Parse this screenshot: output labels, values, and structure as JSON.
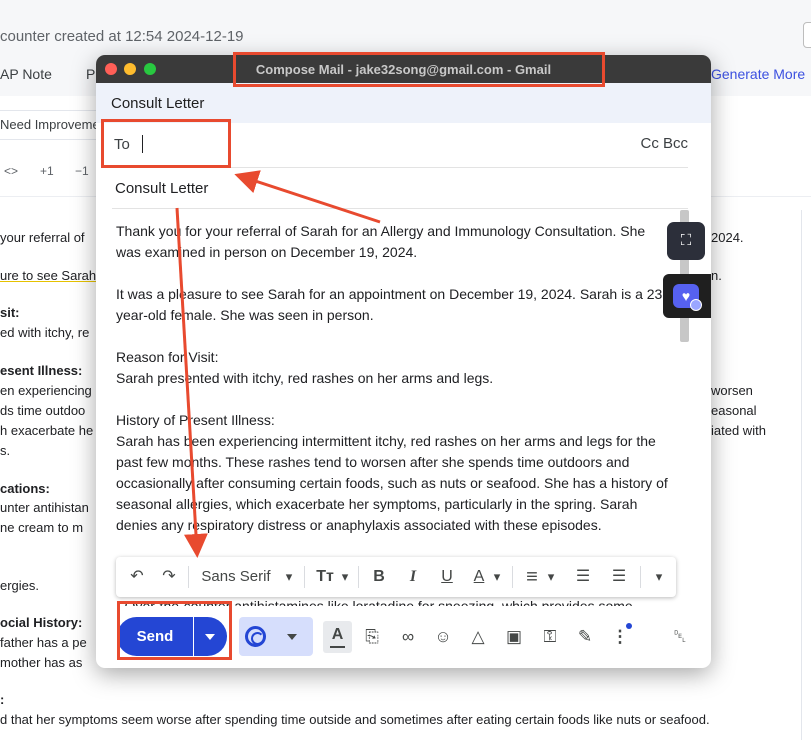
{
  "background": {
    "title": "counter created at 12:54 2024-12-19",
    "tabs": [
      "AP Note",
      "P",
      "Generate More"
    ],
    "chip_label": "Need Improvement",
    "toolbar_items": [
      "<>",
      "+1",
      "−1"
    ],
    "lines": [
      {
        "text": "your referral of",
        "bold": false
      },
      {
        "text": "ure to see Sarah",
        "bold": false
      },
      {
        "text": "sit:",
        "bold": true
      },
      {
        "text": "ed with itchy, re",
        "bold": false
      },
      {
        "text": "esent Illness:",
        "bold": true
      },
      {
        "text": "en experiencing",
        "bold": false
      },
      {
        "text": "ds time outdoo",
        "bold": false
      },
      {
        "text": "h exacerbate he",
        "bold": false
      },
      {
        "text": "s.",
        "bold": false
      },
      {
        "text": "cations:",
        "bold": true
      },
      {
        "text": "unter antihistan",
        "bold": false
      },
      {
        "text": "ne cream to m",
        "bold": false
      },
      {
        "text": "ergies.",
        "bold": false
      },
      {
        "text": "ocial History:",
        "bold": true
      },
      {
        "text": "father has a pe",
        "bold": false
      },
      {
        "text": "mother has as",
        "bold": false
      },
      {
        "text": ":",
        "bold": true
      },
      {
        "text": "d that her symptoms seem worse after spending time outside and sometimes after eating certain foods like nuts or seafood.",
        "bold": false
      }
    ],
    "right_fragments": [
      "2024.",
      "n.",
      "worsen",
      "easonal",
      "iated with"
    ]
  },
  "compose": {
    "window_title": "Compose Mail - jake32song@gmail.com - Gmail",
    "header_subject": "Consult Letter",
    "to_label": "To",
    "cc_bcc": "Cc Bcc",
    "subject": "Consult Letter",
    "body": [
      "Thank you for your referral of Sarah for an Allergy and Immunology Consultation. She was examined in person on December 19, 2024.",
      "It was a pleasure to see Sarah for an appointment on December 19, 2024. Sarah is a 23-year-old female. She was seen in person.",
      "Reason for Visit:",
      "Sarah presented with itchy, red rashes on her arms and legs.",
      "History of Present Illness:",
      "Sarah has been experiencing intermittent itchy, red rashes on her arms and legs for the past few months. These rashes tend to worsen after she spends time outdoors and occasionally after consuming certain foods, such as nuts or seafood. She has a history of seasonal allergies, which exacerbate her symptoms, particularly in the spring. Sarah denies any respiratory distress or anaphylaxis associated with these episodes."
    ],
    "hidden_line": "- Over-the-counter antihistamines like loratadine for sneezing, which provides some",
    "font_name": "Sans Serif",
    "send_label": "Send"
  },
  "icons": {
    "undo": "undo-icon",
    "redo": "redo-icon",
    "text_size": "text-size-icon",
    "bold": "bold-icon",
    "italic": "italic-icon",
    "underline": "underline-icon",
    "text_color": "text-color-icon",
    "align": "align-icon",
    "numbered_list": "numbered-list-icon",
    "bulleted_list": "bulleted-list-icon",
    "more_formatting": "more-formatting-icon",
    "attach": "attach-icon",
    "link": "link-icon",
    "emoji": "emoji-icon",
    "drive": "drive-icon",
    "photo": "photo-icon",
    "lock": "confidential-lock-icon",
    "signature": "signature-pen-icon",
    "more": "more-options-icon",
    "trash": "trash-icon"
  },
  "glyphs": {
    "undo": "↶",
    "redo": "↷",
    "text_size": "Tт",
    "bold": "B",
    "italic": "I",
    "underline": "U",
    "text_color": "A",
    "align": "≡",
    "numbered_list": "☰",
    "bulleted_list": "☰",
    "chevron": "▾",
    "attach": "⎘",
    "link": "∞",
    "emoji": "☺",
    "drive": "△",
    "photo": "▣",
    "lock": "⚿",
    "signature": "✎",
    "more": "⋮",
    "trash": "␡",
    "capture": "⛶",
    "heart": "♥"
  },
  "colors": {
    "send": "#2446d4",
    "annotation": "#e84a2f",
    "titlebar": "#3a3a3a"
  }
}
